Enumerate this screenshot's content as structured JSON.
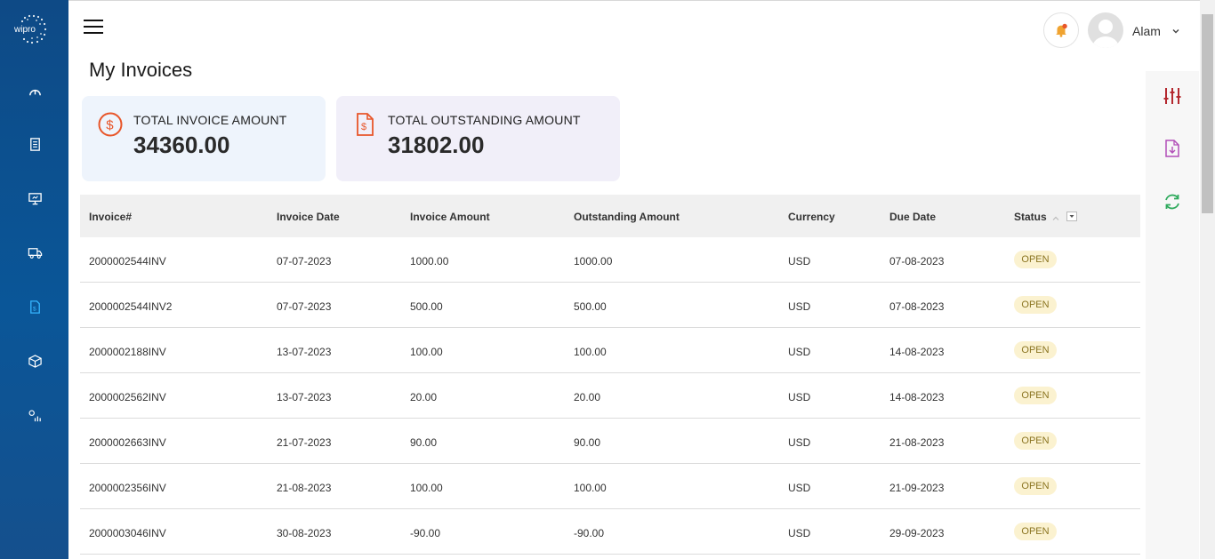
{
  "sidebar": {
    "logo_text": "wipro",
    "items": [
      {
        "icon": "dashboard-icon"
      },
      {
        "icon": "purchase-order-icon"
      },
      {
        "icon": "monitor-icon"
      },
      {
        "icon": "shipment-truck-icon"
      },
      {
        "icon": "invoice-icon",
        "active": true
      },
      {
        "icon": "package-icon"
      },
      {
        "icon": "analytics-icon"
      }
    ]
  },
  "header": {
    "user_name": "Alam"
  },
  "page": {
    "title": "My Invoices"
  },
  "summary": {
    "total_label": "TOTAL INVOICE AMOUNT",
    "total_value": "34360.00",
    "outstanding_label": "TOTAL OUTSTANDING AMOUNT",
    "outstanding_value": "31802.00"
  },
  "table": {
    "columns": [
      "Invoice#",
      "Invoice Date",
      "Invoice Amount",
      "Outstanding Amount",
      "Currency",
      "Due Date",
      "Status"
    ],
    "rows": [
      {
        "invoice": "2000002544INV",
        "date": "07-07-2023",
        "amount": "1000.00",
        "outstanding": "1000.00",
        "currency": "USD",
        "due": "07-08-2023",
        "status": "OPEN"
      },
      {
        "invoice": "2000002544INV2",
        "date": "07-07-2023",
        "amount": "500.00",
        "outstanding": "500.00",
        "currency": "USD",
        "due": "07-08-2023",
        "status": "OPEN"
      },
      {
        "invoice": "2000002188INV",
        "date": "13-07-2023",
        "amount": "100.00",
        "outstanding": "100.00",
        "currency": "USD",
        "due": "14-08-2023",
        "status": "OPEN"
      },
      {
        "invoice": "2000002562INV",
        "date": "13-07-2023",
        "amount": "20.00",
        "outstanding": "20.00",
        "currency": "USD",
        "due": "14-08-2023",
        "status": "OPEN"
      },
      {
        "invoice": "2000002663INV",
        "date": "21-07-2023",
        "amount": "90.00",
        "outstanding": "90.00",
        "currency": "USD",
        "due": "21-08-2023",
        "status": "OPEN"
      },
      {
        "invoice": "2000002356INV",
        "date": "21-08-2023",
        "amount": "100.00",
        "outstanding": "100.00",
        "currency": "USD",
        "due": "21-09-2023",
        "status": "OPEN"
      },
      {
        "invoice": "2000003046INV",
        "date": "30-08-2023",
        "amount": "-90.00",
        "outstanding": "-90.00",
        "currency": "USD",
        "due": "29-09-2023",
        "status": "OPEN"
      }
    ]
  },
  "right_panel": {
    "icons": [
      "filter-sliders-icon",
      "download-file-icon",
      "refresh-icon"
    ]
  },
  "colors": {
    "sidebar": "#0e4a86",
    "accent_orange": "#e8562a",
    "status_bg": "#fbf2d0",
    "status_text": "#8a7420",
    "total_card": "#eef4fc",
    "outstanding_card": "#f1eff9"
  }
}
